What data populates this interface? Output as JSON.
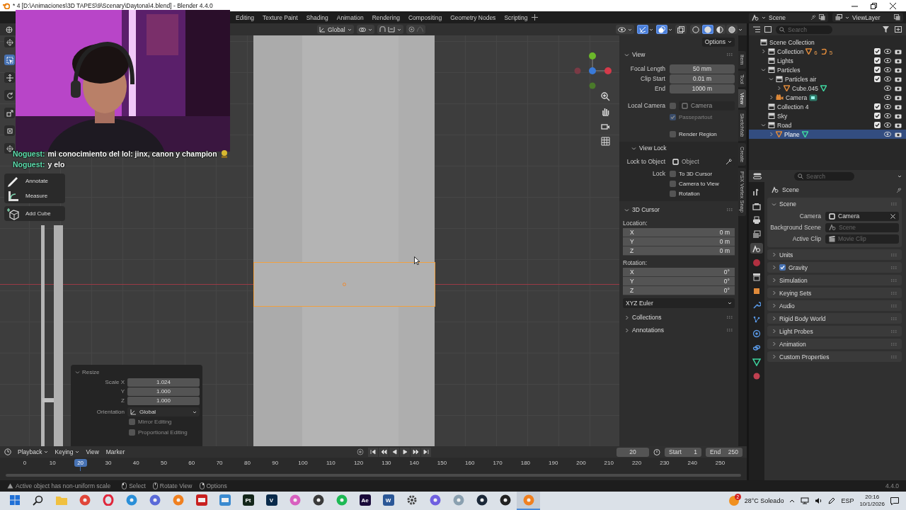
{
  "title_bar": {
    "title": "* 4 [D:\\Animaciones\\3D TAPES\\9\\Scenary\\Daytona\\4.blend] - Blender 4.4.0"
  },
  "workspace_tabs": [
    {
      "label": "Editing",
      "selected": false
    },
    {
      "label": "Texture Paint",
      "selected": false
    },
    {
      "label": "Shading",
      "selected": false
    },
    {
      "label": "Animation",
      "selected": false
    },
    {
      "label": "Rendering",
      "selected": false
    },
    {
      "label": "Compositing",
      "selected": false
    },
    {
      "label": "Geometry Nodes",
      "selected": false
    },
    {
      "label": "Scripting",
      "selected": false
    }
  ],
  "scene": {
    "value": "Scene"
  },
  "view_layer": {
    "value": "ViewLayer"
  },
  "viewport_header": {
    "orientation": "Global",
    "gizmos": true,
    "overlays": true,
    "xray": false,
    "shading": [
      {
        "kind": "wireframe",
        "selected": false
      },
      {
        "kind": "solid",
        "selected": true
      },
      {
        "kind": "material",
        "selected": false
      },
      {
        "kind": "rendered",
        "selected": false
      }
    ]
  },
  "chat": [
    {
      "user": "Noguest:",
      "message": "mi conocimiento del lol: jinx, canon y champion"
    },
    {
      "user": "Noguest:",
      "message": "y elo"
    }
  ],
  "toolbar": {
    "strip": [
      {
        "kind": "cursor",
        "selected": false
      },
      {
        "kind": "select_box",
        "selected": true
      },
      {
        "kind": "move",
        "selected": false
      },
      {
        "kind": "rotate",
        "selected": false
      },
      {
        "kind": "scale",
        "selected": false
      },
      {
        "kind": "transform",
        "selected": false
      },
      {
        "kind": "cursor",
        "selected": false
      }
    ],
    "tools": [
      {
        "kind": "annotate",
        "label": "Annotate"
      },
      {
        "kind": "measure",
        "label": "Measure"
      },
      {
        "kind": "add_cube",
        "label": "Add Cube"
      }
    ]
  },
  "resize_panel": {
    "title": "Resize",
    "expanded": true,
    "fields": [
      {
        "label": "Scale X",
        "value": "1.024"
      },
      {
        "label": "Y",
        "value": "1.000"
      },
      {
        "label": "Z",
        "value": "1.000"
      }
    ],
    "orientation": {
      "label": "Orientation",
      "value": "Global"
    },
    "options": [
      {
        "label": "Mirror Editing",
        "checked": false
      },
      {
        "label": "Proportional Editing",
        "checked": false
      }
    ]
  },
  "sidebar": {
    "options": "Options",
    "tabs": [
      {
        "label": "Item",
        "selected": false
      },
      {
        "label": "Tool",
        "selected": false
      },
      {
        "label": "View",
        "selected": true
      },
      {
        "label": "Sketchfab",
        "selected": false
      },
      {
        "label": "Create",
        "selected": false
      },
      {
        "label": "PSX Vertex Snap",
        "selected": false
      }
    ],
    "view": {
      "title": "View",
      "expanded": true,
      "fields": [
        {
          "label": "Focal Length",
          "value": "50 mm"
        },
        {
          "label": "Clip Start",
          "value": "0.01 m"
        },
        {
          "label": "End",
          "value": "1000 m"
        }
      ],
      "local_camera": {
        "label": "Local Camera",
        "checked": false,
        "placeholder": "Camera"
      },
      "passepartout": {
        "label": "Passepartout",
        "checked": true,
        "disabled": true
      },
      "render_region": {
        "label": "Render Region",
        "checked": false
      }
    },
    "view_lock": {
      "title": "View Lock",
      "expanded": true,
      "lock_to_object": {
        "label": "Lock to Object",
        "placeholder": "Object"
      },
      "lock_label": "Lock",
      "options": [
        {
          "label": "To 3D Cursor",
          "checked": false
        },
        {
          "label": "Camera to View",
          "checked": false
        },
        {
          "label": "Rotation",
          "checked": false
        }
      ]
    },
    "cursor": {
      "title": "3D Cursor",
      "expanded": true,
      "location_label": "Location:",
      "location": [
        {
          "axis": "X",
          "value": "0 m"
        },
        {
          "axis": "Y",
          "value": "0 m"
        },
        {
          "axis": "Z",
          "value": "0 m"
        }
      ],
      "rotation_label": "Rotation:",
      "rotation": [
        {
          "axis": "X",
          "value": "0°"
        },
        {
          "axis": "Y",
          "value": "0°"
        },
        {
          "axis": "Z",
          "value": "0°"
        }
      ],
      "mode": "XYZ Euler"
    },
    "more_panels": [
      {
        "title": "Collections",
        "expanded": false
      },
      {
        "title": "Annotations",
        "expanded": false
      }
    ]
  },
  "outliner": {
    "search_placeholder": "Search",
    "items": [
      {
        "label": "Scene Collection",
        "kind": "scene_collection",
        "selected": false,
        "children": [
          {
            "label": "Collection",
            "kind": "collection",
            "expanded": false,
            "checked": true,
            "selected": false,
            "contents": [
              {
                "kind": "mesh",
                "count": "6"
              },
              {
                "kind": "curve",
                "count": "5"
              }
            ]
          },
          {
            "label": "Lights",
            "kind": "collection",
            "checked": true,
            "selected": false
          },
          {
            "label": "Particles",
            "kind": "collection",
            "expanded": true,
            "checked": true,
            "selected": false,
            "children": [
              {
                "label": "Particles air",
                "kind": "collection",
                "expanded": true,
                "checked": true,
                "selected": false,
                "children": [
                  {
                    "label": "Cube.045",
                    "kind": "mesh_object",
                    "expanded": false,
                    "selected": false,
                    "contents": [
                      {
                        "kind": "mesh_data"
                      }
                    ]
                  }
                ]
              },
              {
                "label": "Camera",
                "kind": "camera_object",
                "expanded": false,
                "selected": false,
                "contents": [
                  {
                    "kind": "camera_data"
                  }
                ]
              }
            ]
          },
          {
            "label": "Collection 4",
            "kind": "collection",
            "checked": true,
            "selected": false
          },
          {
            "label": "Sky",
            "kind": "collection",
            "checked": true,
            "selected": false
          },
          {
            "label": "Road",
            "kind": "collection",
            "expanded": true,
            "checked": true,
            "selected": false,
            "children": [
              {
                "label": "Plane",
                "kind": "mesh_object",
                "expanded": false,
                "selected": true,
                "contents": [
                  {
                    "kind": "mesh_data"
                  }
                ]
              }
            ]
          }
        ]
      }
    ]
  },
  "properties": {
    "search_placeholder": "Search",
    "context": "Scene",
    "tabs": [
      {
        "kind": "tool",
        "selected": false
      },
      {
        "kind": "render",
        "selected": false
      },
      {
        "kind": "output",
        "selected": false
      },
      {
        "kind": "view_layer",
        "selected": false
      },
      {
        "kind": "scene",
        "selected": true
      },
      {
        "kind": "world",
        "selected": false
      },
      {
        "kind": "collection",
        "selected": false
      },
      {
        "kind": "object",
        "selected": false
      },
      {
        "kind": "modifiers",
        "selected": false
      },
      {
        "kind": "particles",
        "selected": false
      },
      {
        "kind": "physics",
        "selected": false
      },
      {
        "kind": "constraints",
        "selected": false
      },
      {
        "kind": "data",
        "selected": false
      },
      {
        "kind": "material",
        "selected": false
      }
    ],
    "scene_panel": {
      "title": "Scene",
      "expanded": true,
      "fields": [
        {
          "kind": "object",
          "label": "Camera",
          "value": "Camera"
        },
        {
          "kind": "scene",
          "label": "Background Scene",
          "placeholder": "Scene"
        },
        {
          "kind": "clip",
          "label": "Active Clip",
          "placeholder": "Movie Clip"
        }
      ]
    },
    "subpanels": [
      {
        "title": "Units",
        "expanded": false
      },
      {
        "title": "Gravity",
        "expanded": false,
        "checked": true
      },
      {
        "title": "Simulation",
        "expanded": false
      },
      {
        "title": "Keying Sets",
        "expanded": false
      },
      {
        "title": "Audio",
        "expanded": false
      },
      {
        "title": "Rigid Body World",
        "expanded": false
      },
      {
        "title": "Light Probes",
        "expanded": false
      },
      {
        "title": "Animation",
        "expanded": false
      },
      {
        "title": "Custom Properties",
        "expanded": false
      }
    ]
  },
  "timeline": {
    "menus": [
      "Playback",
      "Keying",
      "View",
      "Marker"
    ],
    "current_frame": "20",
    "start": {
      "label": "Start",
      "value": "1"
    },
    "end": {
      "label": "End",
      "value": "250"
    },
    "frames": [
      {
        "label": "0",
        "selected": false
      },
      {
        "label": "10",
        "selected": false
      },
      {
        "label": "20",
        "selected": true
      },
      {
        "label": "30",
        "selected": false
      },
      {
        "label": "40",
        "selected": false
      },
      {
        "label": "50",
        "selected": false
      },
      {
        "label": "60",
        "selected": false
      },
      {
        "label": "70",
        "selected": false
      },
      {
        "label": "80",
        "selected": false
      },
      {
        "label": "90",
        "selected": false
      },
      {
        "label": "100",
        "selected": false
      },
      {
        "label": "110",
        "selected": false
      },
      {
        "label": "120",
        "selected": false
      },
      {
        "label": "130",
        "selected": false
      },
      {
        "label": "140",
        "selected": false
      },
      {
        "label": "150",
        "selected": false
      },
      {
        "label": "160",
        "selected": false
      },
      {
        "label": "170",
        "selected": false
      },
      {
        "label": "180",
        "selected": false
      },
      {
        "label": "190",
        "selected": false
      },
      {
        "label": "200",
        "selected": false
      },
      {
        "label": "210",
        "selected": false
      },
      {
        "label": "220",
        "selected": false
      },
      {
        "label": "230",
        "selected": false
      },
      {
        "label": "240",
        "selected": false
      },
      {
        "label": "250",
        "selected": false
      }
    ]
  },
  "status_bar": {
    "warning": "Active object has non-uniform scale",
    "hints": [
      {
        "kind": "left_click",
        "label": "Select"
      },
      {
        "kind": "middle_click",
        "label": "Rotate View"
      },
      {
        "kind": "right_click",
        "label": "Options"
      }
    ],
    "version": "4.4.0"
  },
  "taskbar": {
    "apps": [
      {
        "kind": "start",
        "color": "#1f6fd6",
        "selected": false
      },
      {
        "kind": "search",
        "color": "#222222",
        "selected": false
      },
      {
        "kind": "folder",
        "color": "#f0c040",
        "selected": false
      },
      {
        "kind": "circle",
        "color": "#e0463a",
        "selected": false
      },
      {
        "kind": "ring",
        "color": "#e0253a",
        "selected": false
      },
      {
        "kind": "circle",
        "color": "#2a8fd8",
        "selected": false
      },
      {
        "kind": "circle",
        "color": "#5a6ad8",
        "selected": false
      },
      {
        "kind": "circle",
        "color": "#f08020",
        "selected": false
      },
      {
        "kind": "square",
        "color": "#c82020",
        "selected": false
      },
      {
        "kind": "square",
        "color": "#3a8ad0",
        "selected": false
      },
      {
        "kind": "square",
        "color": "#14261a",
        "label": "Pt",
        "selected": false
      },
      {
        "kind": "square",
        "color": "#0a2a4a",
        "label": "V",
        "selected": false
      },
      {
        "kind": "circle",
        "color": "#d860c0",
        "selected": false
      },
      {
        "kind": "circle",
        "color": "#3a3a3a",
        "selected": false
      },
      {
        "kind": "circle",
        "color": "#1db954",
        "selected": false
      },
      {
        "kind": "square",
        "color": "#1a0a3a",
        "label": "Ae",
        "selected": false
      },
      {
        "kind": "square",
        "color": "#2b5797",
        "label": "W",
        "selected": false
      },
      {
        "kind": "gear",
        "color": "#444444",
        "selected": false
      },
      {
        "kind": "circle",
        "color": "#7060e0",
        "selected": false
      },
      {
        "kind": "circle",
        "color": "#8aa0b0",
        "selected": false
      },
      {
        "kind": "circle",
        "color": "#1b2838",
        "selected": false
      },
      {
        "kind": "circle",
        "color": "#222222",
        "selected": false
      },
      {
        "kind": "circle",
        "color": "#f08020",
        "selected": true
      }
    ],
    "weather": {
      "badge": "2",
      "text": "28°C Soleado"
    },
    "language": "ESP",
    "time": "20:16",
    "date": "10/1/2026"
  }
}
